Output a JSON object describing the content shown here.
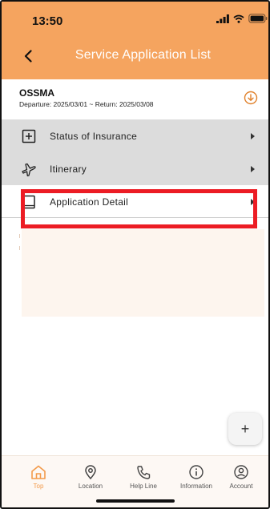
{
  "status_bar": {
    "time": "13:50"
  },
  "header": {
    "title": "Service Application List"
  },
  "trip": {
    "name": "OSSMA",
    "dates": "Departure: 2025/03/01 ~ Return: 2025/03/08"
  },
  "menu": {
    "items": [
      {
        "label": "Status of Insurance",
        "icon": "plus-square-icon"
      },
      {
        "label": "Itinerary",
        "icon": "airplane-icon"
      },
      {
        "label": "Application Detail",
        "icon": "book-icon",
        "selected": true
      }
    ]
  },
  "fab": {
    "label": "+"
  },
  "tabs": [
    {
      "label": "Top",
      "icon": "home-icon",
      "active": true
    },
    {
      "label": "Location",
      "icon": "location-pin-icon"
    },
    {
      "label": "Help Line",
      "icon": "phone-icon"
    },
    {
      "label": "Information",
      "icon": "info-icon"
    },
    {
      "label": "Account",
      "icon": "account-icon"
    }
  ],
  "colors": {
    "header": "#f5a45f",
    "highlight": "#ec1c24",
    "active_tab": "#f39a4a"
  }
}
